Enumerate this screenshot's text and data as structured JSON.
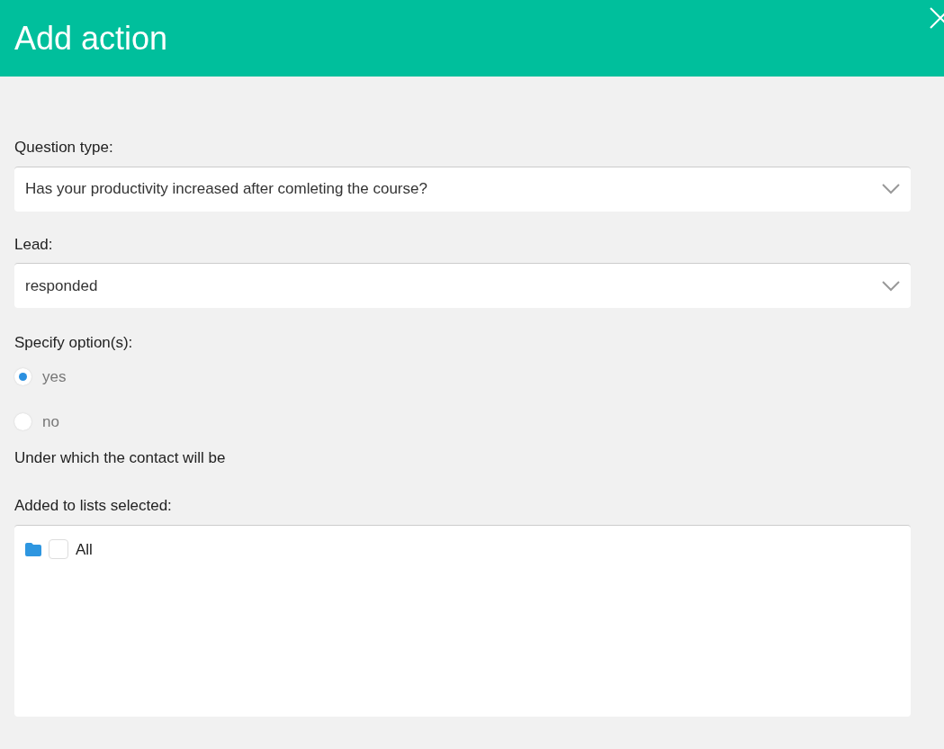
{
  "header": {
    "title": "Add action"
  },
  "fields": [
    {
      "label": "Question type:",
      "value": "Has your productivity increased after comleting the course?"
    },
    {
      "label": "Lead:",
      "value": "responded"
    }
  ],
  "options": {
    "label": "Specify option(s):",
    "items": [
      {
        "label": "yes",
        "selected": true
      },
      {
        "label": "no",
        "selected": false
      }
    ]
  },
  "note": "Under which the contact will be",
  "lists": {
    "label": "Added to lists selected:",
    "items": [
      {
        "label": "All",
        "checked": false
      }
    ]
  }
}
